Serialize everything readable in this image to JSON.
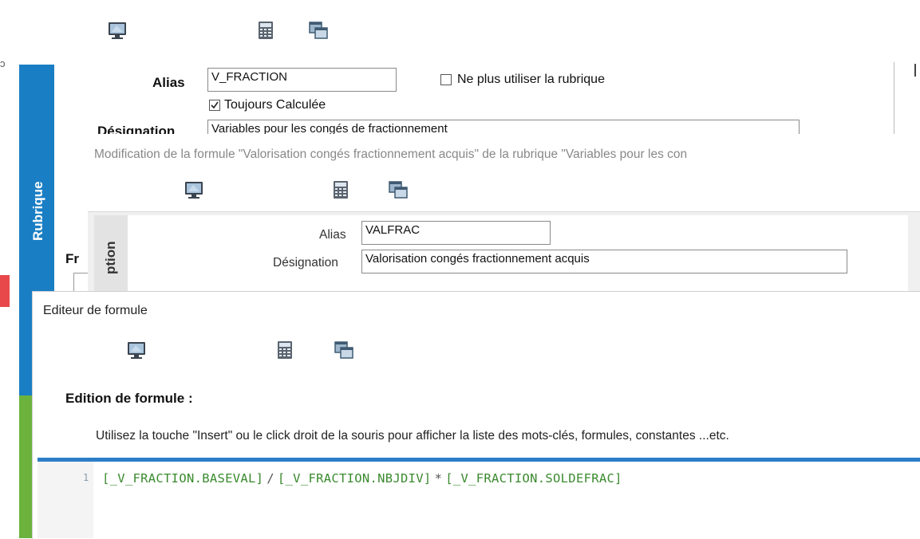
{
  "window1": {
    "alias_label": "Alias",
    "alias_value": "V_FRACTION",
    "ne_plus_utiliser_label": "Ne plus utiliser la rubrique",
    "ne_plus_utiliser_checked": false,
    "toujours_calculee_label": "Toujours Calculée",
    "toujours_calculee_checked": true,
    "designation_label": "Désignation",
    "designation_value": "Variables pour les congés de fractionnement",
    "side_tab_label": "Rubrique",
    "partial_label": "Fr"
  },
  "window2": {
    "title": "Modification de la formule \"Valorisation congés fractionnement acquis\" de la rubrique \"Variables pour les con",
    "alias_label": "Alias",
    "alias_value": "VALFRAC",
    "designation_label": "Désignation",
    "designation_value": "Valorisation congés fractionnement acquis",
    "side_tab_label": "ption"
  },
  "window3": {
    "title": "Editeur de formule",
    "section_heading": "Edition de formule :",
    "hint": "Utilisez la touche \"Insert\" ou le click droit de la souris pour afficher la liste des mots-clés, formules, constantes ...etc.",
    "editor": {
      "line_number": "1",
      "tokens": [
        "[_V_FRACTION.BASEVAL]",
        "/",
        "[_V_FRACTION.NBJDIV]",
        "*",
        "[_V_FRACTION.SOLDEFRAC]"
      ]
    }
  },
  "icons": [
    "monitor-icon",
    "calculator-icon",
    "copy-windows-icon"
  ],
  "colors": {
    "rubrique_tab": "#1a7ec4",
    "green_tab": "#6cb33e",
    "editor_accent": "#2d7ec8",
    "code_green": "#3a8a2e"
  }
}
